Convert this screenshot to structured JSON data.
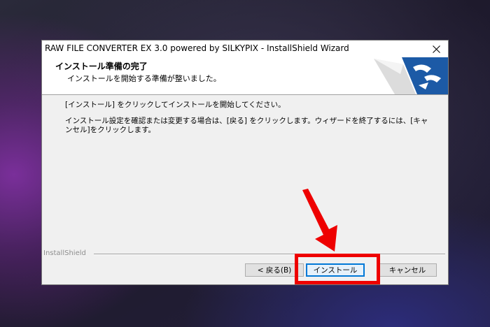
{
  "window": {
    "title": "RAW FILE CONVERTER EX 3.0 powered by SILKYPIX - InstallShield Wizard"
  },
  "header": {
    "title": "インストール準備の完了",
    "subtitle": "インストールを開始する準備が整いました。"
  },
  "body": {
    "line1": "[インストール] をクリックしてインストールを開始してください。",
    "line2": "インストール設定を確認または変更する場合は、[戻る] をクリックします。ウィザードを終了するには、[キャンセル]をクリックします。"
  },
  "footer": {
    "brand": "InstallShield"
  },
  "buttons": {
    "back": "< 戻る(B)",
    "install": "インストール",
    "cancel": "キャンセル"
  },
  "icons": {
    "close": "close-icon",
    "logo": "installshield-logo",
    "arrow": "red-arrow-annotation"
  },
  "colors": {
    "highlight": "#ee0000",
    "focus_border": "#0078d7",
    "logo_blue": "#1c5aa6"
  }
}
